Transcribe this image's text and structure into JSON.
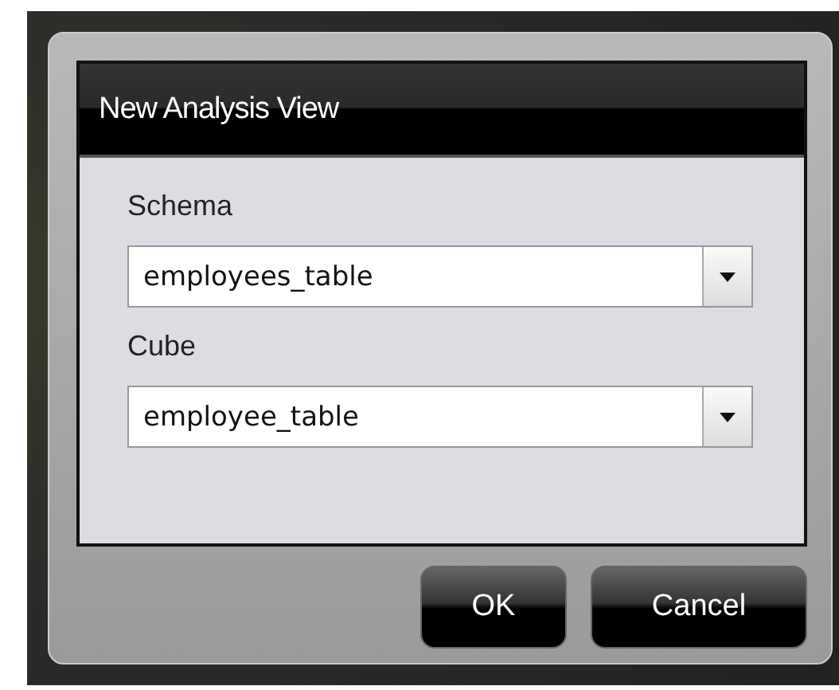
{
  "dialog": {
    "title": "New Analysis View",
    "fields": [
      {
        "label": "Schema",
        "value": "employees_table"
      },
      {
        "label": "Cube",
        "value": "employee_table"
      }
    ],
    "buttons": [
      "OK",
      "Cancel"
    ]
  }
}
